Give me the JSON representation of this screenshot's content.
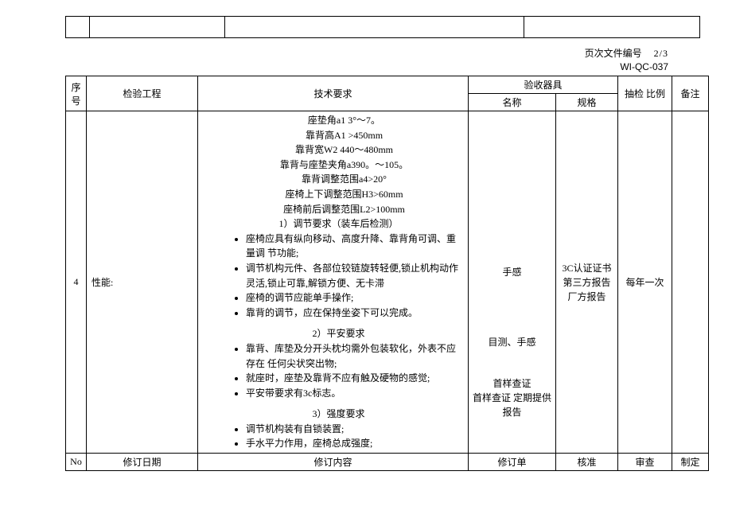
{
  "header": {
    "page_label": "页次文件编号",
    "page_num": "2/3",
    "doc_id": "WI-QC-037"
  },
  "columns": {
    "no": "序号",
    "item": "检验工程",
    "req": "技术要求",
    "instr_group": "验收器具",
    "instr_name": "名称",
    "instr_spec": "规格",
    "sampling": "抽检 比例",
    "note": "备注"
  },
  "row": {
    "no": "4",
    "item": "性能:",
    "specs": {
      "l1": "座垫角a1 3°〜7。",
      "l2": "靠背高A1 >450mm",
      "l3": "靠背宽W2 440〜480mm",
      "l4": "靠背与座垫夹角a390。〜105。",
      "l5": "靠背调整范围a4>20°",
      "l6": "座椅上下调整范围H3>60mm",
      "l7": "座椅前后调整范围L2>100mm"
    },
    "sect1": {
      "title": "1）调节要求（装车后检测）",
      "b1": "座椅应具有纵向移动、高度升降、靠背角可调、重量调 节功能;",
      "b2": "调节机构元件、各部位铰链旋转轻便,锁止机构动作灵活,锁止可靠,解锁方便、无卡滞",
      "b3": "座椅的调节应能单手操作;",
      "b4": "靠背的调节，应在保持坐姿下可以完成。"
    },
    "sect2": {
      "title": "2）平安要求",
      "b1": "靠背、库垫及分开头枕均需外包装软化，外表不应存在 任何尖状突出物;",
      "b2": "就座时，座垫及靠背不应有触及硬物的感觉;",
      "b3": "平安带要求有3c标志。"
    },
    "sect3": {
      "title": "3）强度要求",
      "b1": "调节机构装有自锁装置;",
      "b2": "手水平力作用，座椅总成强度;"
    },
    "instr": {
      "n1": "手感",
      "n2": "目测、手感",
      "n3": "首样查证",
      "n4": " 首样查证 定期提供报告"
    },
    "spec": {
      "s1": " 3C认证证书",
      "s2": " 第三方报告 厂方报告"
    },
    "sampling": "每年一次"
  },
  "footer": {
    "no": "No",
    "date": "修订日期",
    "content": "修订内容",
    "order": "修订单",
    "approve": "核准",
    "review": "审查",
    "make": "制定"
  }
}
